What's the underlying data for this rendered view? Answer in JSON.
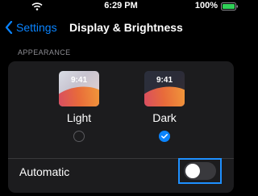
{
  "status_bar": {
    "time": "6:29 PM",
    "battery_percent": "100%"
  },
  "nav": {
    "back_label": "Settings",
    "title": "Display & Brightness"
  },
  "appearance": {
    "section_title": "APPEARANCE",
    "options": [
      {
        "label": "Light",
        "preview_time": "9:41",
        "selected": false
      },
      {
        "label": "Dark",
        "preview_time": "9:41",
        "selected": true
      }
    ],
    "automatic": {
      "label": "Automatic",
      "enabled": false
    }
  },
  "colors": {
    "accent": "#0a84ff",
    "background": "#000000",
    "card": "#1c1c1e",
    "highlight": "#1e90ff"
  }
}
